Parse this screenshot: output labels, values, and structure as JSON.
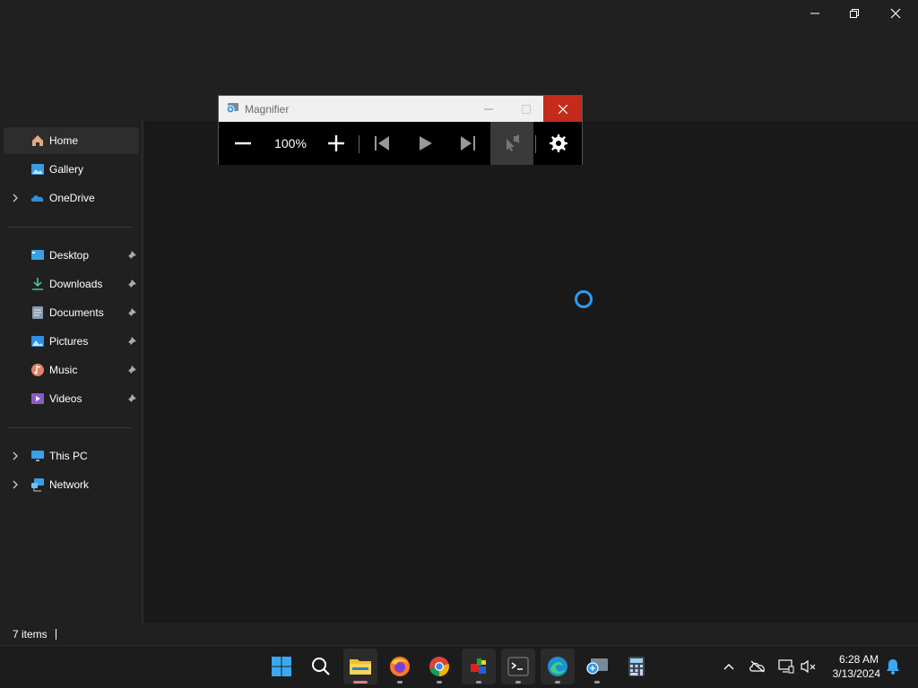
{
  "explorer": {
    "window_controls": [
      "minimize",
      "restore",
      "close"
    ],
    "sidebar": {
      "top_items": [
        {
          "label": "Home",
          "icon": "home-icon",
          "active": true,
          "expandable": false
        },
        {
          "label": "Gallery",
          "icon": "gallery-icon",
          "active": false,
          "expandable": false
        },
        {
          "label": "OneDrive",
          "icon": "onedrive-icon",
          "active": false,
          "expandable": true
        }
      ],
      "pinned_items": [
        {
          "label": "Desktop",
          "icon": "desktop-icon"
        },
        {
          "label": "Downloads",
          "icon": "downloads-icon"
        },
        {
          "label": "Documents",
          "icon": "documents-icon"
        },
        {
          "label": "Pictures",
          "icon": "pictures-icon"
        },
        {
          "label": "Music",
          "icon": "music-icon"
        },
        {
          "label": "Videos",
          "icon": "videos-icon"
        }
      ],
      "bottom_items": [
        {
          "label": "This PC",
          "icon": "this-pc-icon"
        },
        {
          "label": "Network",
          "icon": "network-icon"
        }
      ]
    },
    "status": {
      "item_count": "7 items"
    }
  },
  "magnifier": {
    "title": "Magnifier",
    "zoom": "100%",
    "accent": "#c42b1c"
  },
  "taskbar": {
    "apps": [
      "start",
      "search",
      "file-explorer",
      "firefox",
      "chrome",
      "app-cube",
      "terminal",
      "edge",
      "magnifier",
      "calculator"
    ],
    "clock": {
      "time": "6:28 AM",
      "date": "3/13/2024"
    }
  },
  "colors": {
    "accent_blue": "#2d9bf0",
    "close_red": "#c42b1c",
    "active_indicator": "#e47a8a"
  }
}
